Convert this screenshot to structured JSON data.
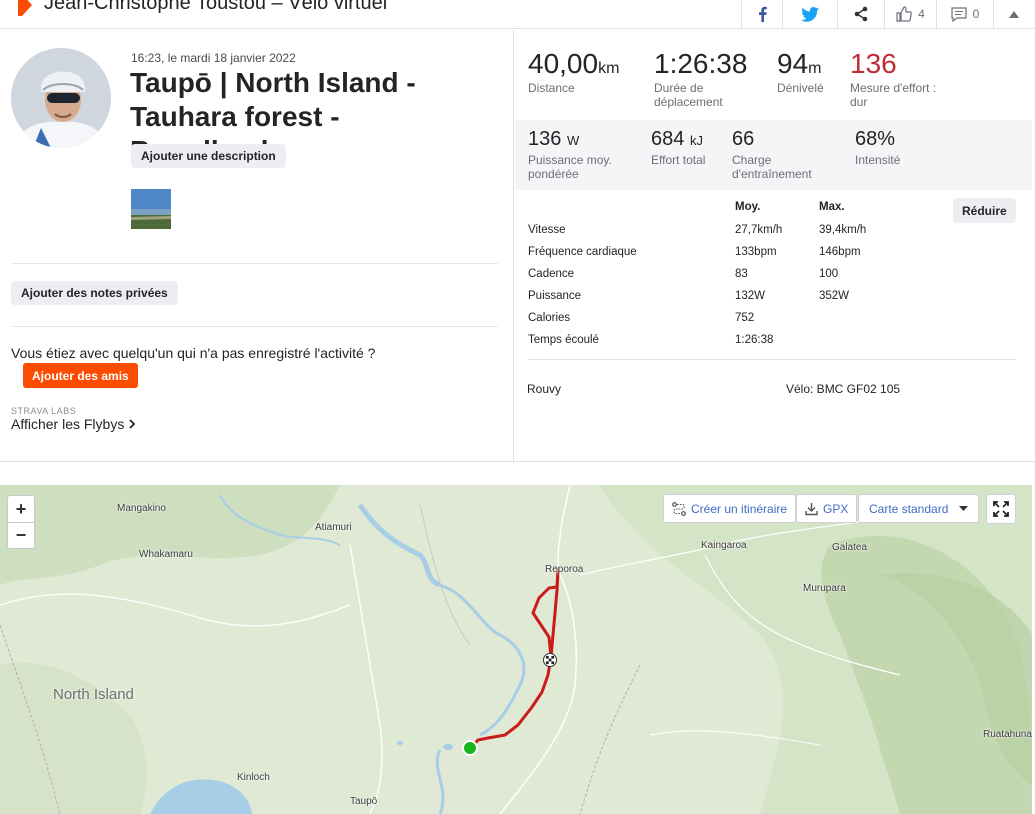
{
  "header": {
    "title": "Jean-Christophe Toustou – Vélo virtuel",
    "kudos_count": "4",
    "comments_count": "0"
  },
  "activity": {
    "datetime": "16:23, le mardi 18 janvier 2022",
    "title": "Taupō | North Island - Tauhara forest - Broadlands",
    "add_description_label": "Ajouter une description",
    "private_notes_label": "Ajouter des notes privées",
    "question": "Vous étiez avec quelqu'un qui n'a pas enregistré l'activité ?",
    "add_friends_label": "Ajouter des amis",
    "labs_label": "STRAVA LABS",
    "flybys_label": "Afficher les Flybys"
  },
  "stats": {
    "distance": {
      "value": "40,00",
      "unit": "km",
      "label": "Distance"
    },
    "moving_time": {
      "value": "1:26:38",
      "label": "Durée de déplacement"
    },
    "elevation": {
      "value": "94",
      "unit": "m",
      "label": "Dénivelé"
    },
    "effort": {
      "value": "136",
      "label": "Mesure d'effort : dur"
    },
    "weighted_power": {
      "value": "136",
      "unit": "W",
      "label": "Puissance moy. pondérée"
    },
    "total_work": {
      "value": "684",
      "unit": "kJ",
      "label": "Effort total"
    },
    "training_load": {
      "value": "66",
      "label": "Charge d'entraînement"
    },
    "intensity": {
      "value": "68%",
      "label": "Intensité"
    }
  },
  "details": {
    "reduce_label": "Réduire",
    "col_avg": "Moy.",
    "col_max": "Max.",
    "rows": [
      {
        "label": "Vitesse",
        "avg": "27,7km/h",
        "max": "39,4km/h"
      },
      {
        "label": "Fréquence cardiaque",
        "avg": "133bpm",
        "max": "146bpm"
      },
      {
        "label": "Cadence",
        "avg": "83",
        "max": "100"
      },
      {
        "label": "Puissance",
        "avg": "132W",
        "max": "352W"
      },
      {
        "label": "Calories",
        "avg": "752",
        "max": ""
      },
      {
        "label": "Temps écoulé",
        "avg": "1:26:38",
        "max": ""
      }
    ],
    "device": "Rouvy",
    "bike": "Vélo: BMC GF02 105"
  },
  "map": {
    "zoom_in": "+",
    "zoom_out": "−",
    "create_route_label": "Créer un itinéraire",
    "gpx_label": "GPX",
    "map_type_label": "Carte standard",
    "places": {
      "mangakino": "Mangakino",
      "atiamuri": "Atiamuri",
      "whakamaru": "Whakamaru",
      "reporoa": "Reporoa",
      "kaingaroa": "Kaingaroa",
      "galatea": "Galatea",
      "murupara": "Murupara",
      "north_island": "North Island",
      "kinloch": "Kinloch",
      "taupo": "Taupō",
      "ruatahuna": "Ruatahuna"
    },
    "route_color": "#cc1a1a",
    "start_color": "#18b51b"
  },
  "colors": {
    "accent": "#fc4c02",
    "effort_red": "#c12b36"
  }
}
